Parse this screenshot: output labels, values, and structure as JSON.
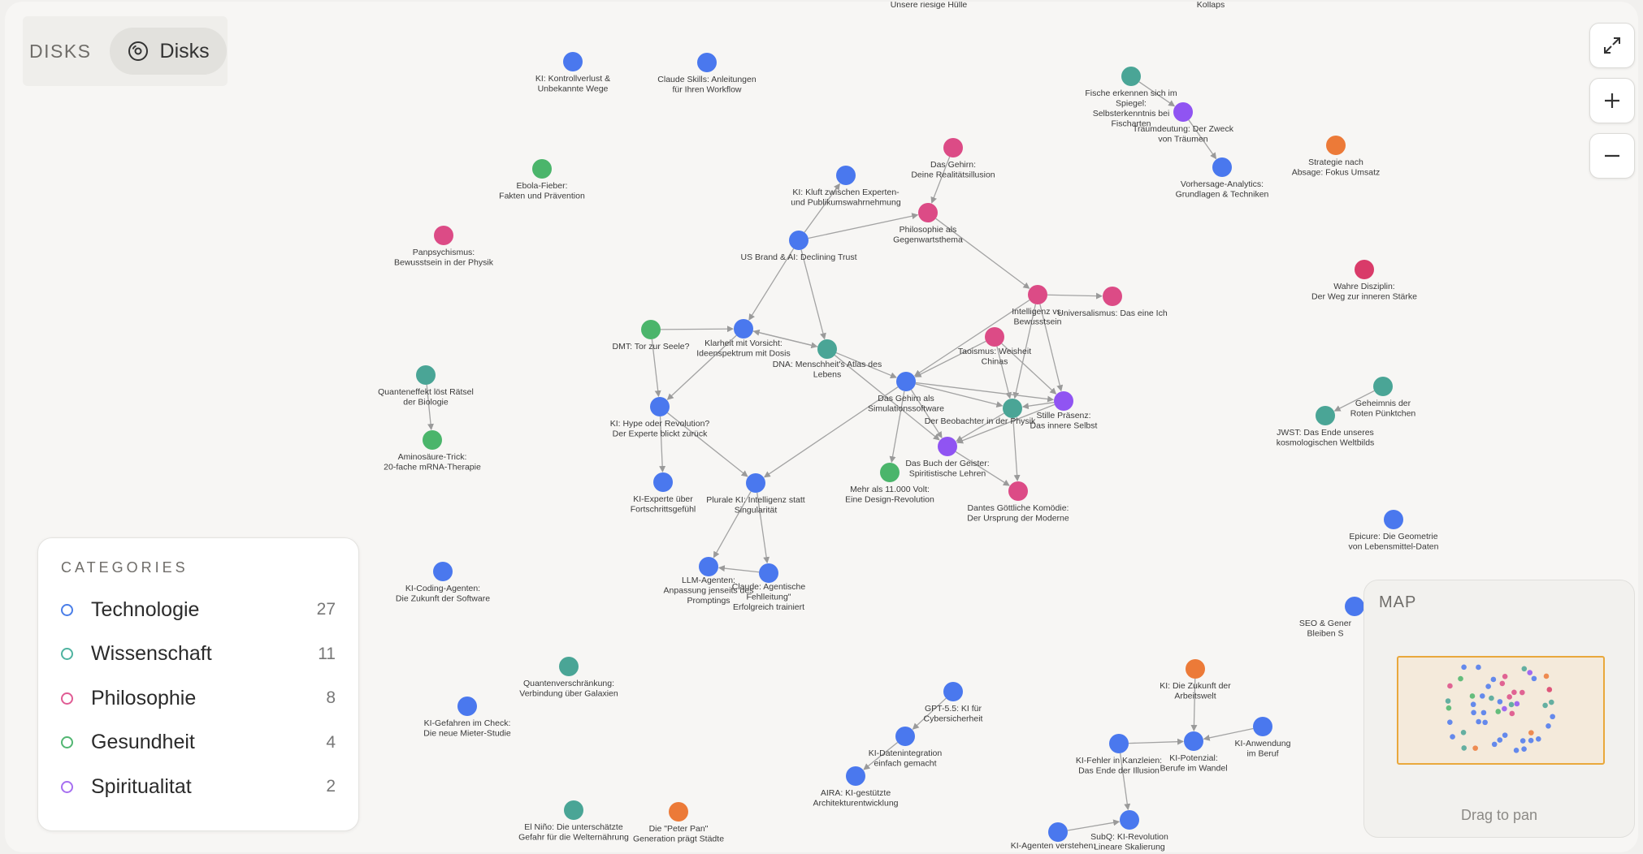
{
  "header": {
    "title": "DISKS",
    "view_button": "Disks"
  },
  "controls": {
    "expand_icon": "expand-icon",
    "zoom_in_icon": "plus-icon",
    "zoom_out_icon": "minus-icon"
  },
  "categories_panel": {
    "title": "CATEGORIES",
    "items": [
      {
        "label": "Technologie",
        "count": "27",
        "color": "#4a7ee8"
      },
      {
        "label": "Wissenschaft",
        "count": "11",
        "color": "#4fb3a0"
      },
      {
        "label": "Philosophie",
        "count": "8",
        "color": "#e05c94"
      },
      {
        "label": "Gesundheit",
        "count": "4",
        "color": "#52b672"
      },
      {
        "label": "Spiritualitat",
        "count": "2",
        "color": "#a66ff0"
      }
    ]
  },
  "minimap": {
    "title": "MAP",
    "hint": "Drag to pan"
  },
  "colors": {
    "technologie": "#4a78ee",
    "wissenschaft": "#4aa596",
    "philosophie": "#dc4b86",
    "gesundheit": "#4bb56b",
    "spiritualitat": "#9054f2",
    "other": "#ec7a38",
    "crimson": "#d93b69"
  },
  "graph": {
    "nodes": [
      {
        "id": "kontrollverlust",
        "cat": "technologie",
        "label": [
          "KI: Kontrollverlust &",
          "Unbekannte Wege"
        ]
      },
      {
        "id": "claude-skills",
        "cat": "technologie",
        "label": [
          "Claude Skills: Anleitungen",
          "für Ihren Workflow"
        ]
      },
      {
        "id": "ebola",
        "cat": "gesundheit",
        "label": [
          "Ebola-Fieber:",
          "Fakten und Prävention"
        ]
      },
      {
        "id": "panpsychismus",
        "cat": "philosophie",
        "label": [
          "Panpsychismus:",
          "Bewusstsein in der Physik"
        ]
      },
      {
        "id": "quanteneffekt",
        "cat": "wissenschaft",
        "label": [
          "Quanteneffekt löst Rätsel",
          "der Biologie"
        ]
      },
      {
        "id": "aminosaeure",
        "cat": "gesundheit",
        "label": [
          "Aminosäure-Trick:",
          "20-fache mRNA-Therapie"
        ]
      },
      {
        "id": "kluft",
        "cat": "technologie",
        "label": [
          "KI: Kluft zwischen Experten-",
          "und Publikumswahrnehmung"
        ]
      },
      {
        "id": "gehirn-illusion",
        "cat": "philosophie",
        "label": [
          "Das Gehirn:",
          "Deine Realitätsillusion"
        ]
      },
      {
        "id": "philo-gegenwart",
        "cat": "philosophie",
        "label": [
          "Philosophie als",
          "Gegenwartsthema"
        ]
      },
      {
        "id": "us-brand",
        "cat": "technologie",
        "label": [
          "US Brand & AI: Declining Trust"
        ]
      },
      {
        "id": "dmt",
        "cat": "gesundheit",
        "label": [
          "DMT: Tor zur Seele?"
        ]
      },
      {
        "id": "klarheit",
        "cat": "technologie",
        "label": [
          "Klarheit mit Vorsicht:",
          "Ideenspektrum mit Dosis"
        ]
      },
      {
        "id": "dna",
        "cat": "wissenschaft",
        "label": [
          "DNA: Menschheit's Atlas des",
          "Lebens"
        ]
      },
      {
        "id": "hype",
        "cat": "technologie",
        "label": [
          "KI: Hype oder Revolution?",
          "Der Experte blickt zurück"
        ]
      },
      {
        "id": "fortschritt",
        "cat": "technologie",
        "label": [
          "KI-Experte über",
          "Fortschrittsgefühl"
        ]
      },
      {
        "id": "plurale",
        "cat": "technologie",
        "label": [
          "Plurale KI: Intelligenz statt",
          "Singularität"
        ]
      },
      {
        "id": "llm-agenten",
        "cat": "technologie",
        "label": [
          "LLM-Agenten:",
          "Anpassung jenseits des",
          "Promptings"
        ]
      },
      {
        "id": "claude-agentisch",
        "cat": "technologie",
        "label": [
          "Claude: Agentische",
          "Fehlleitung\"",
          "Erfolgreich trainiert"
        ]
      },
      {
        "id": "gehirn-sim",
        "cat": "technologie",
        "label": [
          "Das Gehirn als",
          "Simulationssoftware"
        ]
      },
      {
        "id": "intelligenz",
        "cat": "philosophie",
        "label": [
          "Intelligenz vs.",
          "Bewusstsein"
        ]
      },
      {
        "id": "universalismus",
        "cat": "philosophie",
        "label": [
          "Universalismus: Das eine Ich"
        ]
      },
      {
        "id": "taoismus",
        "cat": "philosophie",
        "label": [
          "Taoismus: Weisheit",
          "Chinas"
        ]
      },
      {
        "id": "beobachter",
        "cat": "wissenschaft",
        "label": [
          "Der Beobachter in der Physik"
        ]
      },
      {
        "id": "stille",
        "cat": "spiritualitat",
        "label": [
          "Stille Präsenz:",
          "Das innere Selbst"
        ]
      },
      {
        "id": "buch-geister",
        "cat": "spiritualitat",
        "label": [
          "Das Buch der Geister:",
          "Spiritistische Lehren"
        ]
      },
      {
        "id": "volt",
        "cat": "gesundheit",
        "label": [
          "Mehr als 11.000 Volt:",
          "Eine Design-Revolution"
        ]
      },
      {
        "id": "dante",
        "cat": "philosophie",
        "label": [
          "Dantes Göttliche Komödie:",
          "Der Ursprung der Moderne"
        ]
      },
      {
        "id": "fische",
        "cat": "wissenschaft",
        "label": [
          "Fische erkennen sich im",
          "Spiegel:",
          "Selbsterkenntnis bei",
          "Fischarten"
        ]
      },
      {
        "id": "traumdeutung",
        "cat": "spiritualitat",
        "label": [
          "Traumdeutung: Der Zweck",
          "von Träumen"
        ]
      },
      {
        "id": "vorhersage",
        "cat": "technologie",
        "label": [
          "Vorhersage-Analytics:",
          "Grundlagen & Techniken"
        ]
      },
      {
        "id": "strategie",
        "cat": "other",
        "label": [
          "Strategie nach",
          "Absage: Fokus Umsatz"
        ]
      },
      {
        "id": "disziplin",
        "cat": "crimson",
        "label": [
          "Wahre Disziplin:",
          "Der Weg zur inneren Stärke"
        ]
      },
      {
        "id": "geheimnis",
        "cat": "wissenschaft",
        "label": [
          "Geheimnis der",
          "Roten Pünktchen"
        ]
      },
      {
        "id": "jwst",
        "cat": "wissenschaft",
        "label": [
          "JWST: Das Ende unseres",
          "kosmologischen Weltbilds"
        ]
      },
      {
        "id": "epicure",
        "cat": "technologie",
        "label": [
          "Epicure: Die Geometrie",
          "von Lebensmittel-Daten"
        ]
      },
      {
        "id": "coding-agenten",
        "cat": "technologie",
        "label": [
          "KI-Coding-Agenten:",
          "Die Zukunft der Software"
        ]
      },
      {
        "id": "quantenverschraenkung",
        "cat": "wissenschaft",
        "label": [
          "Quantenverschränkung:",
          "Verbindung über Galaxien"
        ]
      },
      {
        "id": "gefahren",
        "cat": "technologie",
        "label": [
          "KI-Gefahren im Check:",
          "Die neue Mieter-Studie"
        ]
      },
      {
        "id": "gpt55",
        "cat": "technologie",
        "label": [
          "GPT-5.5: KI für",
          "Cybersicherheit"
        ]
      },
      {
        "id": "datenintegration",
        "cat": "technologie",
        "label": [
          "KI-Datenintegration",
          "einfach gemacht"
        ]
      },
      {
        "id": "aira",
        "cat": "technologie",
        "label": [
          "AIRA: KI-gestützte",
          "Architekturentwicklung"
        ]
      },
      {
        "id": "elnino",
        "cat": "wissenschaft",
        "label": [
          "El Niño: Die unterschätzte",
          "Gefahr für die Welternährung"
        ]
      },
      {
        "id": "peterpan",
        "cat": "other",
        "label": [
          "Die \"Peter Pan\"",
          "Generation prägt Städte"
        ]
      },
      {
        "id": "zukunft-arbeit",
        "cat": "other",
        "label": [
          "KI: Die Zukunft der",
          "Arbeitswelt"
        ]
      },
      {
        "id": "kanzleien",
        "cat": "technologie",
        "label": [
          "KI-Fehler in Kanzleien:",
          "Das Ende der Illusion"
        ]
      },
      {
        "id": "potenzial",
        "cat": "technologie",
        "label": [
          "KI-Potenzial:",
          "Berufe im Wandel"
        ]
      },
      {
        "id": "anwendung",
        "cat": "technologie",
        "label": [
          "KI-Anwendung",
          "im Beruf"
        ]
      },
      {
        "id": "subq",
        "cat": "technologie",
        "label": [
          "SubQ: KI-Revolution",
          "Lineare Skalierung"
        ]
      },
      {
        "id": "agenten-verstehen",
        "cat": "technologie",
        "label": [
          "KI-Agenten verstehen:"
        ]
      },
      {
        "id": "seo",
        "cat": "technologie",
        "label": [
          "SEO & Gener",
          "Bleiben S"
        ]
      },
      {
        "id": "top-huelle",
        "cat": "none",
        "label": [
          "Unsere riesige Hülle"
        ]
      },
      {
        "id": "top-kollaps",
        "cat": "none",
        "label": [
          "Kollaps"
        ]
      }
    ],
    "edges": [
      [
        "fische",
        "traumdeutung"
      ],
      [
        "traumdeutung",
        "vorhersage"
      ],
      [
        "gehirn-illusion",
        "philo-gegenwart"
      ],
      [
        "us-brand",
        "philo-gegenwart"
      ],
      [
        "us-brand",
        "kluft"
      ],
      [
        "us-brand",
        "klarheit"
      ],
      [
        "us-brand",
        "dna"
      ],
      [
        "philo-gegenwart",
        "intelligenz"
      ],
      [
        "intelligenz",
        "universalismus"
      ],
      [
        "intelligenz",
        "gehirn-sim"
      ],
      [
        "intelligenz",
        "stille"
      ],
      [
        "intelligenz",
        "beobachter"
      ],
      [
        "dmt",
        "klarheit"
      ],
      [
        "dmt",
        "hype"
      ],
      [
        "klarheit",
        "dna"
      ],
      [
        "dna",
        "klarheit"
      ],
      [
        "klarheit",
        "hype"
      ],
      [
        "dna",
        "gehirn-sim"
      ],
      [
        "dna",
        "buch-geister"
      ],
      [
        "hype",
        "fortschritt"
      ],
      [
        "hype",
        "plurale"
      ],
      [
        "gehirn-sim",
        "plurale"
      ],
      [
        "plurale",
        "llm-agenten"
      ],
      [
        "plurale",
        "claude-agentisch"
      ],
      [
        "claude-agentisch",
        "llm-agenten"
      ],
      [
        "taoismus",
        "gehirn-sim"
      ],
      [
        "taoismus",
        "beobachter"
      ],
      [
        "taoismus",
        "stille"
      ],
      [
        "gehirn-sim",
        "beobachter"
      ],
      [
        "gehirn-sim",
        "stille"
      ],
      [
        "gehirn-sim",
        "volt"
      ],
      [
        "gehirn-sim",
        "buch-geister"
      ],
      [
        "stille",
        "beobachter"
      ],
      [
        "stille",
        "buch-geister"
      ],
      [
        "beobachter",
        "buch-geister"
      ],
      [
        "beobachter",
        "dante"
      ],
      [
        "buch-geister",
        "dante"
      ],
      [
        "quanteneffekt",
        "aminosaeure"
      ],
      [
        "geheimnis",
        "jwst"
      ],
      [
        "gpt55",
        "datenintegration"
      ],
      [
        "datenintegration",
        "aira"
      ],
      [
        "zukunft-arbeit",
        "potenzial"
      ],
      [
        "kanzleien",
        "potenzial"
      ],
      [
        "anwendung",
        "potenzial"
      ],
      [
        "kanzleien",
        "subq"
      ],
      [
        "agenten-verstehen",
        "subq"
      ]
    ]
  }
}
